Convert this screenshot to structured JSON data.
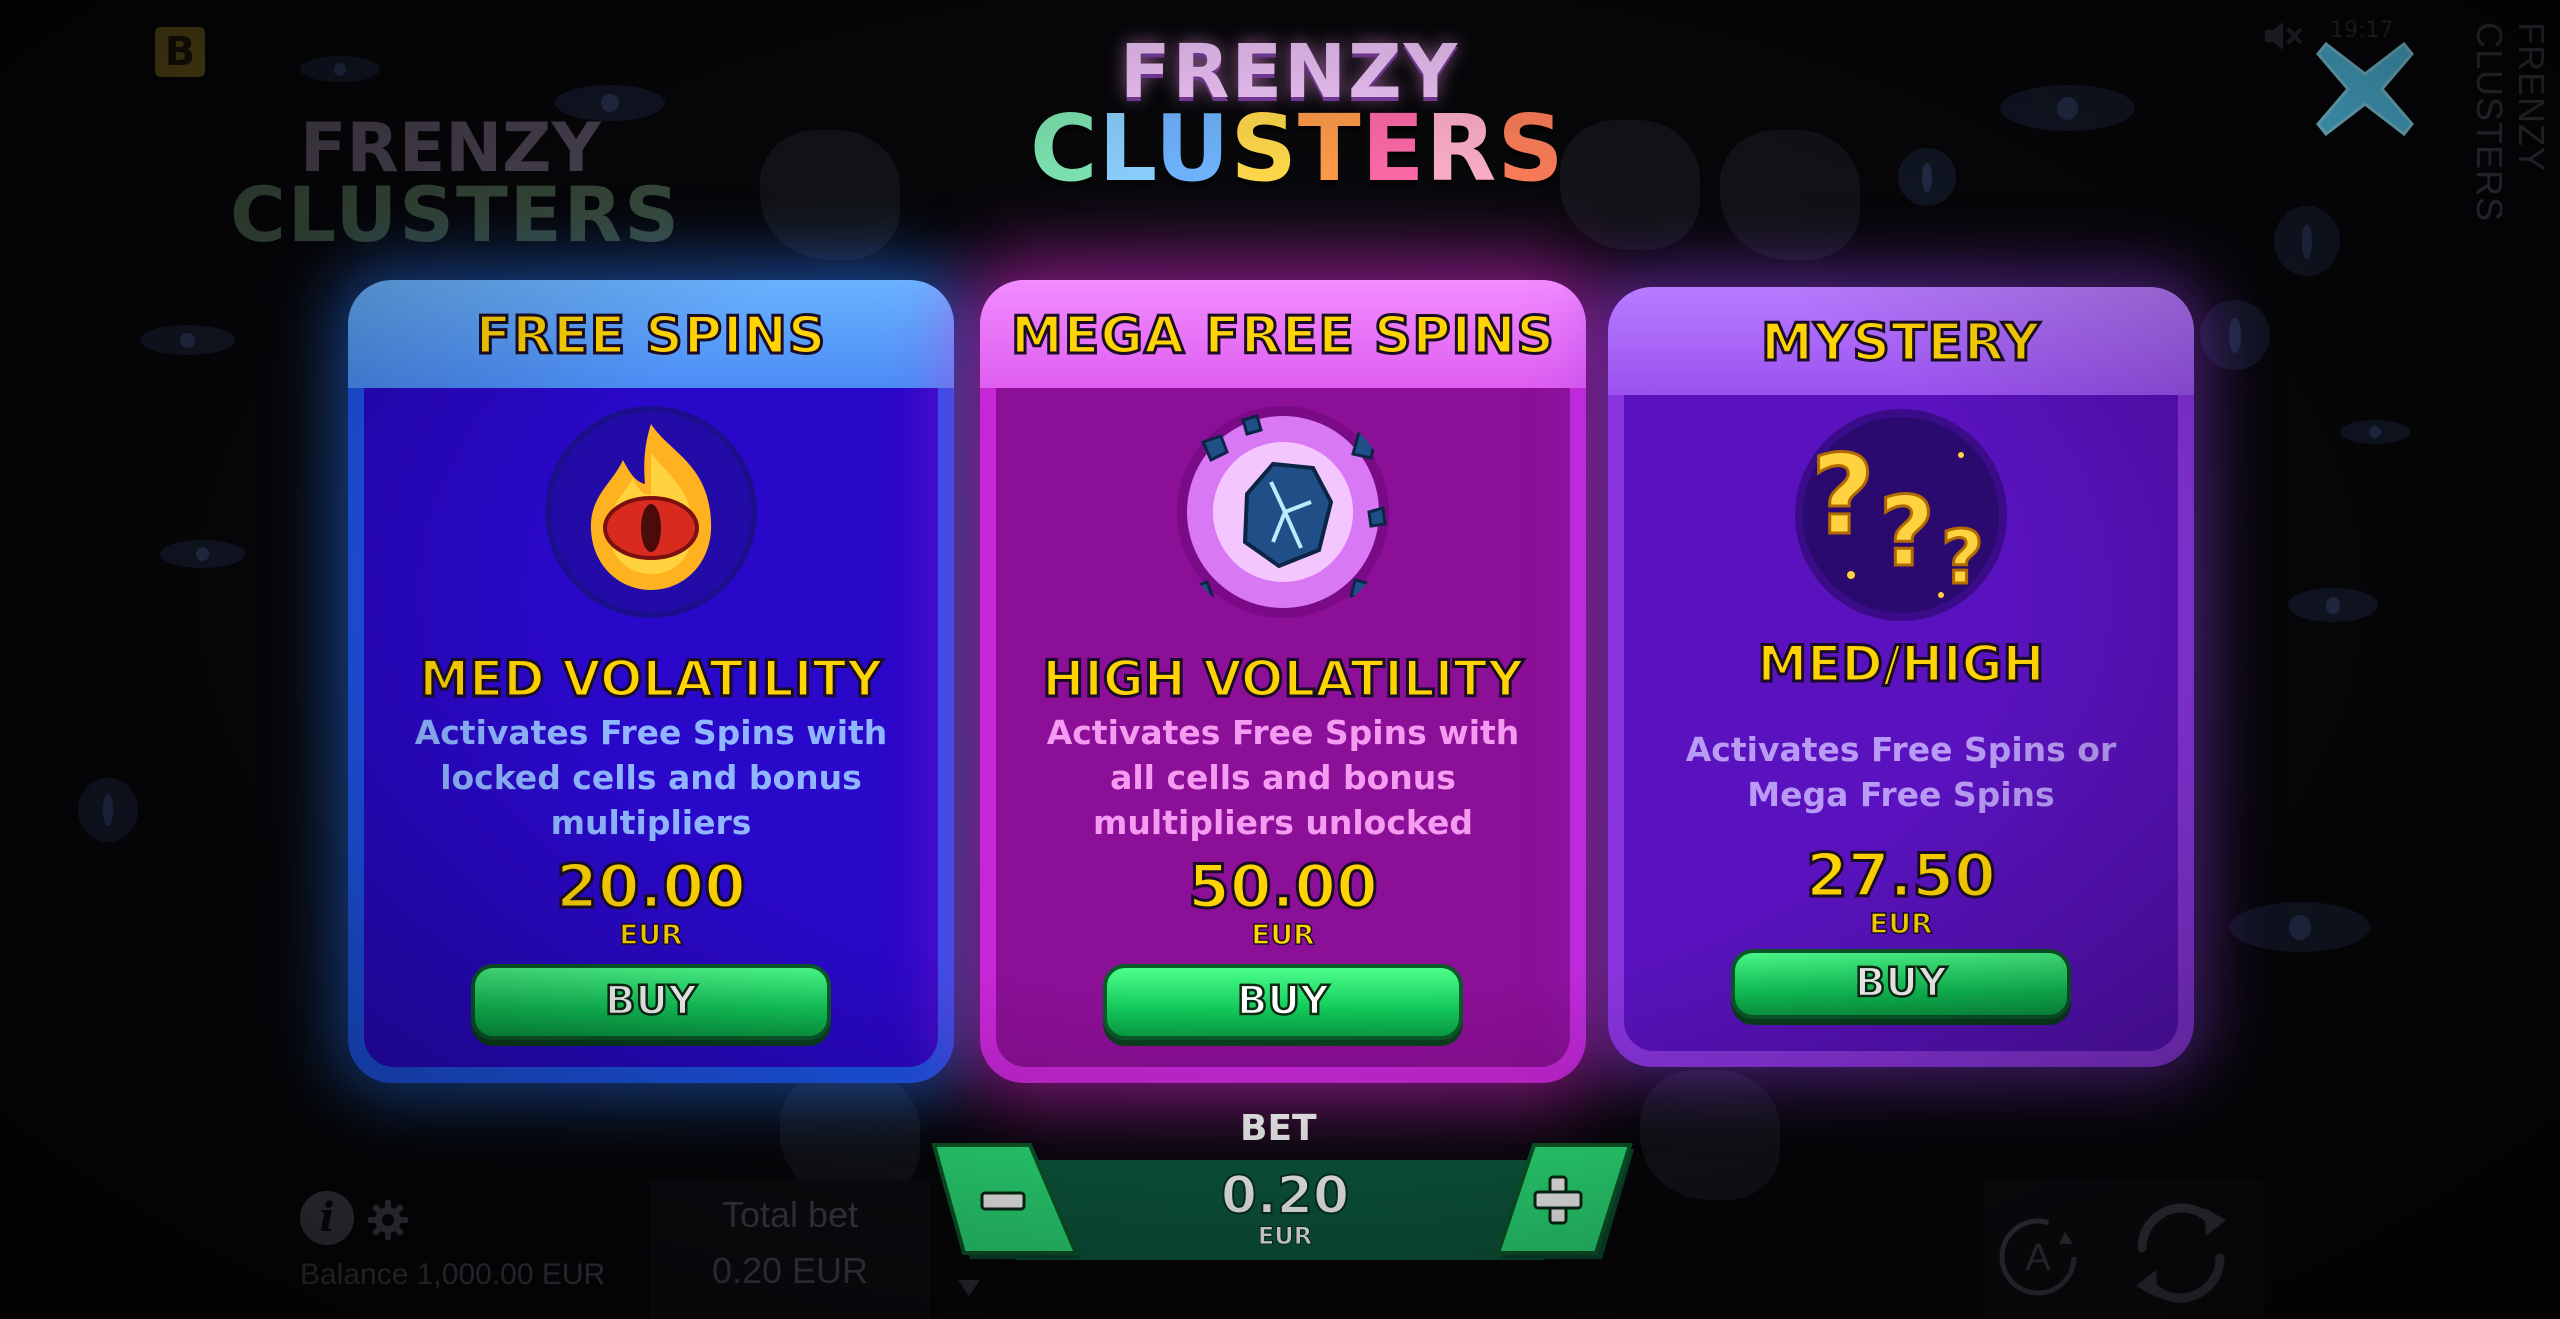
{
  "app": {
    "brand_badge": "B",
    "clock": "19:17",
    "side_title": "FRENZY CLUSTERS"
  },
  "background_logo": {
    "line1": "FRENZY",
    "line2": "CLUSTERS"
  },
  "logo": {
    "line1": "FRENZY",
    "line2_letters": [
      "C",
      "L",
      "U",
      "S",
      "T",
      "E",
      "R",
      "S"
    ],
    "line2_colors": [
      "#7fe6b2",
      "#8ad0ff",
      "#6fb4ff",
      "#ffd84a",
      "#ff9b4a",
      "#ff6aa8",
      "#ffb0c8",
      "#ff7f5a"
    ]
  },
  "cards": [
    {
      "id": "free-spins",
      "title": "FREE SPINS",
      "icon": "flaming-eye-icon",
      "volatility": "MED VOLATILITY",
      "description": "Activates Free Spins with locked cells and bonus multipliers",
      "price": "20.00",
      "currency": "EUR",
      "buy_label": "BUY",
      "accent": "#1d55e8"
    },
    {
      "id": "mega-free-spins",
      "title": "MEGA FREE SPINS",
      "icon": "exploding-rock-icon",
      "volatility": "HIGH VOLATILITY",
      "description": "Activates Free Spins with all cells and bonus multipliers unlocked",
      "price": "50.00",
      "currency": "EUR",
      "buy_label": "BUY",
      "accent": "#c727d6"
    },
    {
      "id": "mystery",
      "title": "MYSTERY",
      "icon": "question-marks-icon",
      "volatility": "MED/HIGH",
      "description": "Activates Free Spins or Mega Free Spins",
      "price": "27.50",
      "currency": "EUR",
      "buy_label": "BUY",
      "accent": "#8b35e0"
    }
  ],
  "bet": {
    "label": "BET",
    "value": "0.20",
    "currency": "EUR"
  },
  "footer": {
    "balance": "Balance 1,000.00 EUR",
    "total_bet_label": "Total bet",
    "total_bet_value": "0.20 EUR",
    "auto_label": "A"
  }
}
